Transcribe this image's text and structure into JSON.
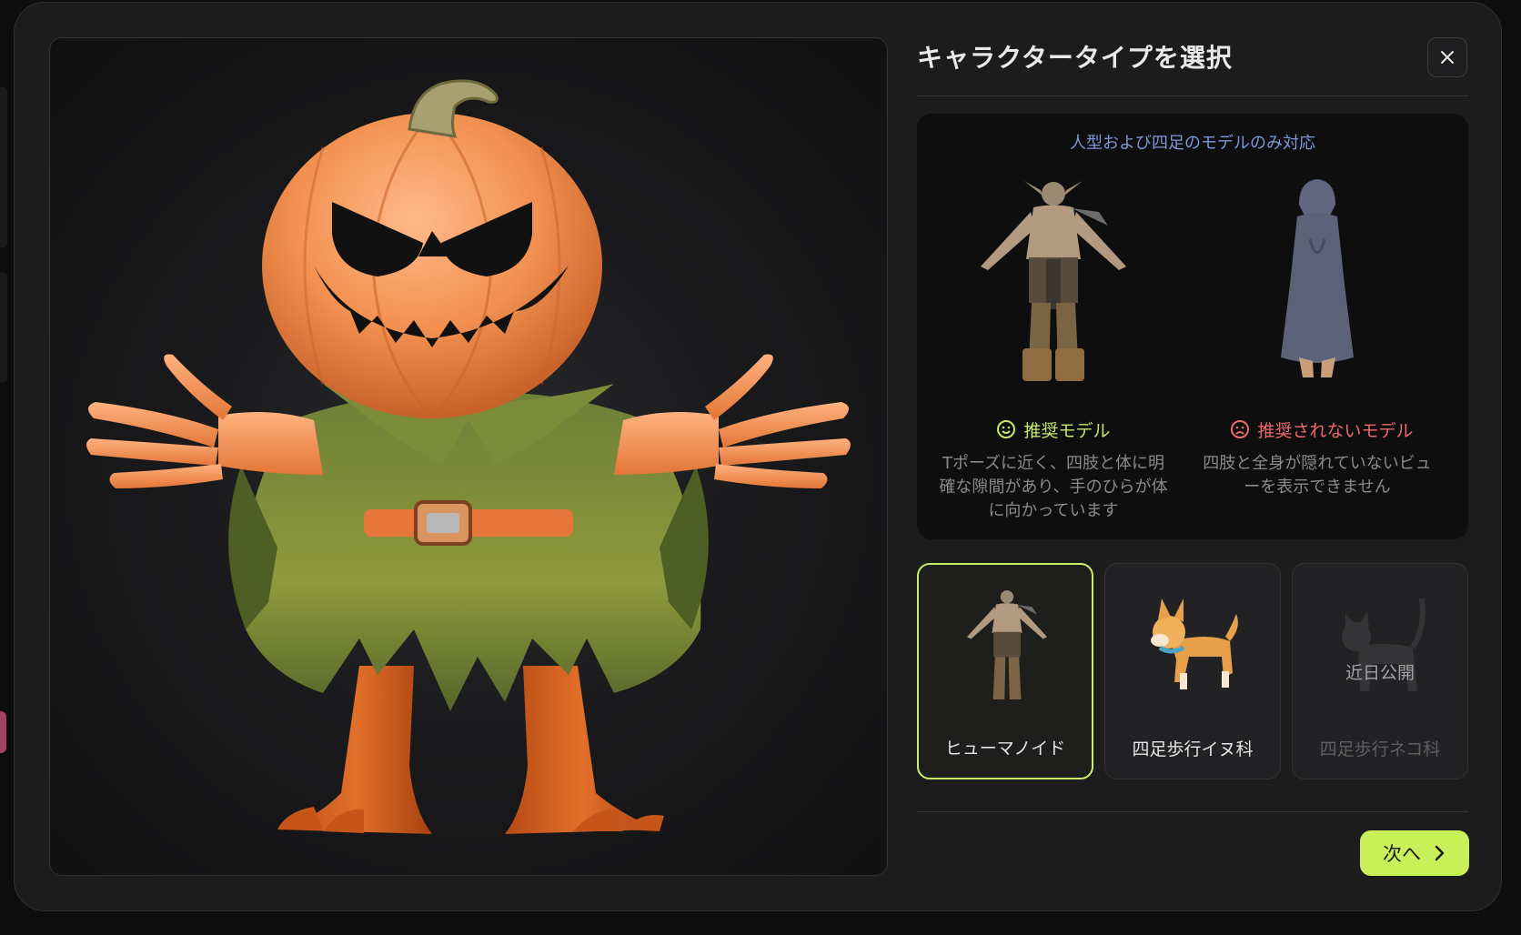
{
  "dialog": {
    "title": "キャラクタータイプを選択",
    "close_icon": "close-icon"
  },
  "viewer": {
    "model": "pumpkin-head scarecrow character in T-pose"
  },
  "guide": {
    "note": "人型および四足のモデルのみ対応",
    "recommended": {
      "label": "推奨モデル",
      "icon": "smile-icon",
      "color": "#c8e86b",
      "description_lines": [
        "Tポーズに近く、四肢と体に明",
        "確な隙間があり、手のひらが体",
        "に向かっています"
      ]
    },
    "not_recommended": {
      "label": "推奨されないモデル",
      "icon": "frown-icon",
      "color": "#ee6a6a",
      "description_lines": [
        "四肢と全身が隠れていないビュ",
        "ーを表示できません"
      ]
    }
  },
  "types": [
    {
      "label": "ヒューマノイド",
      "selected": true,
      "disabled": false
    },
    {
      "label": "四足歩行イヌ科",
      "selected": false,
      "disabled": false
    },
    {
      "label": "四足歩行ネコ科",
      "selected": false,
      "disabled": true,
      "badge": "近日公開"
    }
  ],
  "footer": {
    "next_label": "次へ",
    "next_icon": "chevron-right-icon",
    "accent": "#c8f159"
  }
}
